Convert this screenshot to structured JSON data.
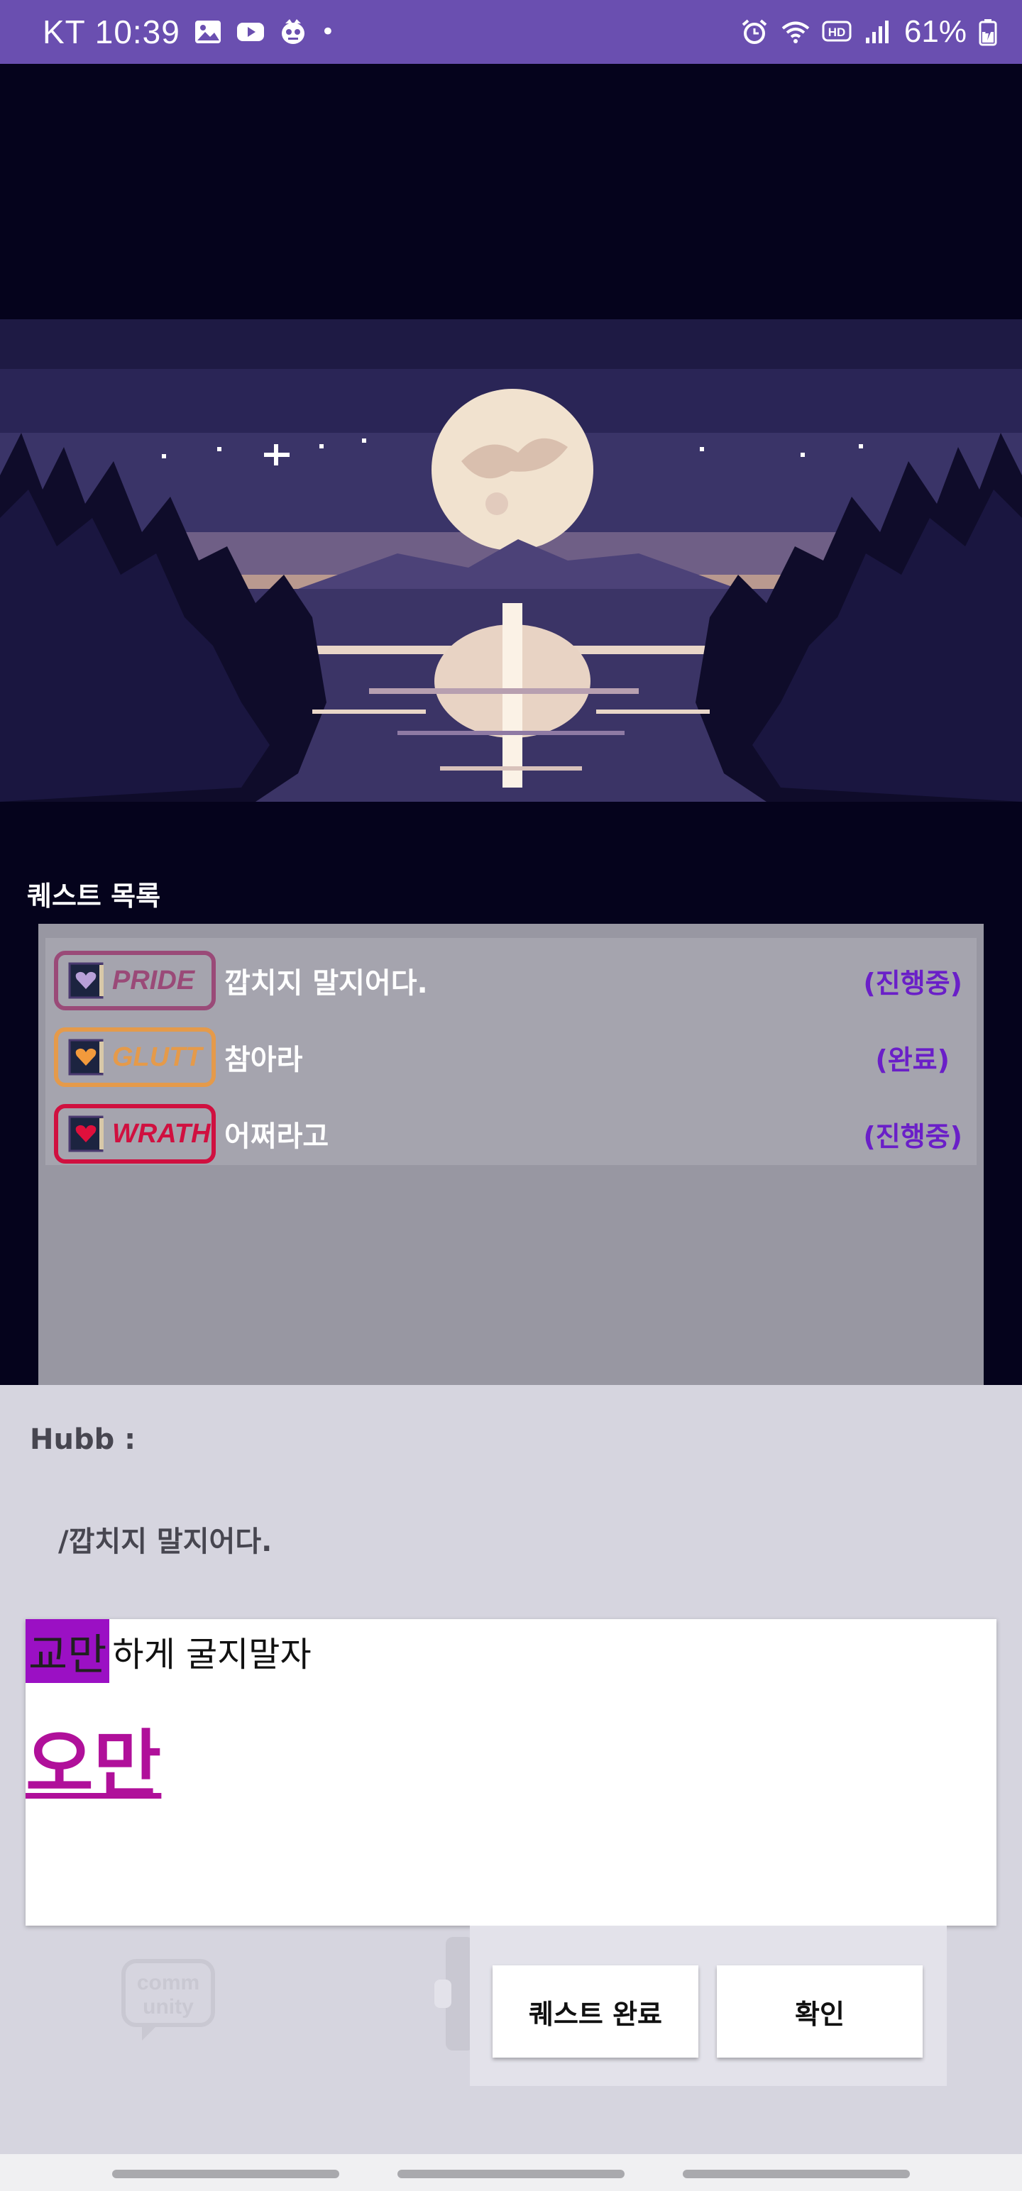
{
  "status_bar": {
    "carrier_time": "KT 10:39",
    "dot": "•",
    "battery": "61%"
  },
  "quests": {
    "title": "퀘스트 목록",
    "items": [
      {
        "tag": "PRIDE",
        "name": "깝치지 말지어다.",
        "status": "(진행중)",
        "color": "#9a4a78",
        "heart": "#b8a0d8"
      },
      {
        "tag": "GLUTT",
        "name": "참아라",
        "status": "(완료)",
        "color": "#e59a4a",
        "heart": "#f29a3c"
      },
      {
        "tag": "WRATH",
        "name": "어쩌라고",
        "status": "(진행중)",
        "color": "#d01040",
        "heart": "#e0103c"
      }
    ]
  },
  "dialog": {
    "speaker": "Hubb :",
    "line": "/깝치지 말지어다."
  },
  "answer": {
    "highlight": "교만",
    "rest": "하게 굴지말자",
    "big": "오만"
  },
  "buttons": {
    "quest_complete": "퀘스트 완료",
    "confirm": "확인"
  },
  "colors": {
    "status_bar": "#6a4fb0",
    "status_text": "#6a1fc8",
    "highlight": "#9b10c4",
    "big_word": "#b0109a"
  }
}
